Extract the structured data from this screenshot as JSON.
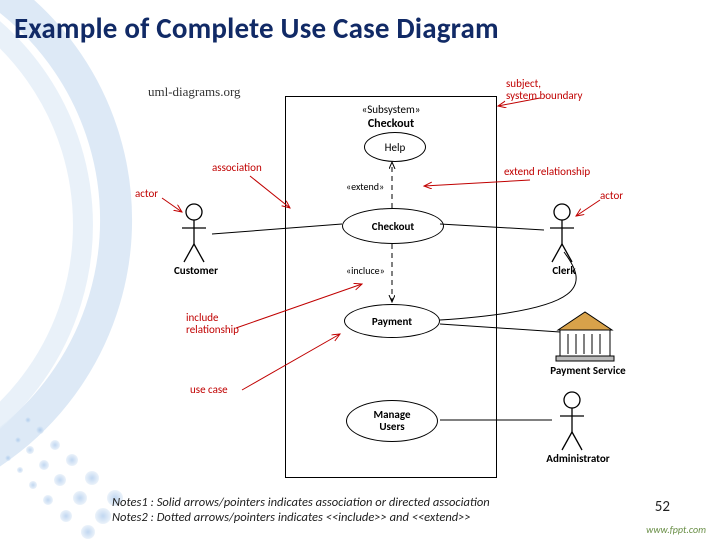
{
  "title": "Example of Complete Use Case Diagram",
  "source": "uml-diagrams.org",
  "boundary": {
    "stereotype": "«Subsystem»",
    "name": "Checkout"
  },
  "usecases": {
    "help": "Help",
    "checkout": "Checkout",
    "payment": "Payment",
    "manage": "Manage\nUsers"
  },
  "dependencies": {
    "extend": "«extend»",
    "include": "«incluce»"
  },
  "red_labels": {
    "subject": "subject,\nsystem boundary",
    "association": "association",
    "actor_left": "actor",
    "actor_right": "actor",
    "extend_rel": "extend relationship",
    "include_rel": "include\nrelationship",
    "use_case": "use case"
  },
  "actors": {
    "customer": "Customer",
    "clerk": "Clerk",
    "payment_service": "Payment Service",
    "administrator": "Administrator"
  },
  "notes": {
    "n1": "Notes1 : Solid arrows/pointers indicates association or directed association",
    "n2": "Notes2 : Dotted arrows/pointers indicates <<include>> and <<extend>>"
  },
  "page": "52",
  "fppt": "www.fppt.com"
}
